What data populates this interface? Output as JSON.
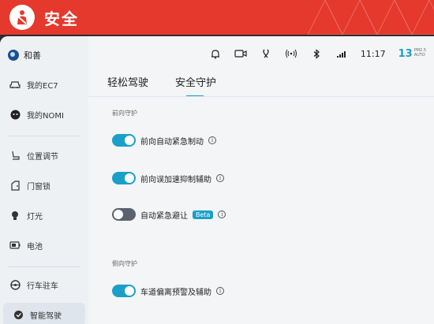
{
  "banner": {
    "title": "安全",
    "color": "#e4392c"
  },
  "profile": {
    "name": "和善"
  },
  "sidebar": {
    "items": [
      {
        "label": "我的EC7",
        "icon": "car-icon"
      },
      {
        "label": "我的NOMI",
        "icon": "nomi-icon"
      },
      {
        "label": "位置调节",
        "icon": "seat-icon"
      },
      {
        "label": "门窗锁",
        "icon": "door-icon"
      },
      {
        "label": "灯光",
        "icon": "light-icon"
      },
      {
        "label": "电池",
        "icon": "battery-icon"
      },
      {
        "label": "行车驻车",
        "icon": "steering-icon"
      },
      {
        "label": "智能驾驶",
        "icon": "assist-icon"
      }
    ]
  },
  "status": {
    "time": "11:17",
    "temperature": "13",
    "temp_unit_top": "PM2.5",
    "temp_unit_bottom": "AUTO"
  },
  "tabs": [
    {
      "label": "轻松驾驶"
    },
    {
      "label": "安全守护"
    }
  ],
  "sections": {
    "front": {
      "label": "前向守护",
      "items": [
        {
          "label": "前向自动紧急制动",
          "enabled": true
        },
        {
          "label": "前向误加速抑制辅助",
          "enabled": true
        },
        {
          "label": "自动紧急避让",
          "enabled": false,
          "badge": "Beta"
        }
      ]
    },
    "side": {
      "label": "侧向守护",
      "items": [
        {
          "label": "车道偏离预警及辅助",
          "enabled": true
        }
      ]
    }
  },
  "info_glyph": "i",
  "accent": "#1aa0c8"
}
